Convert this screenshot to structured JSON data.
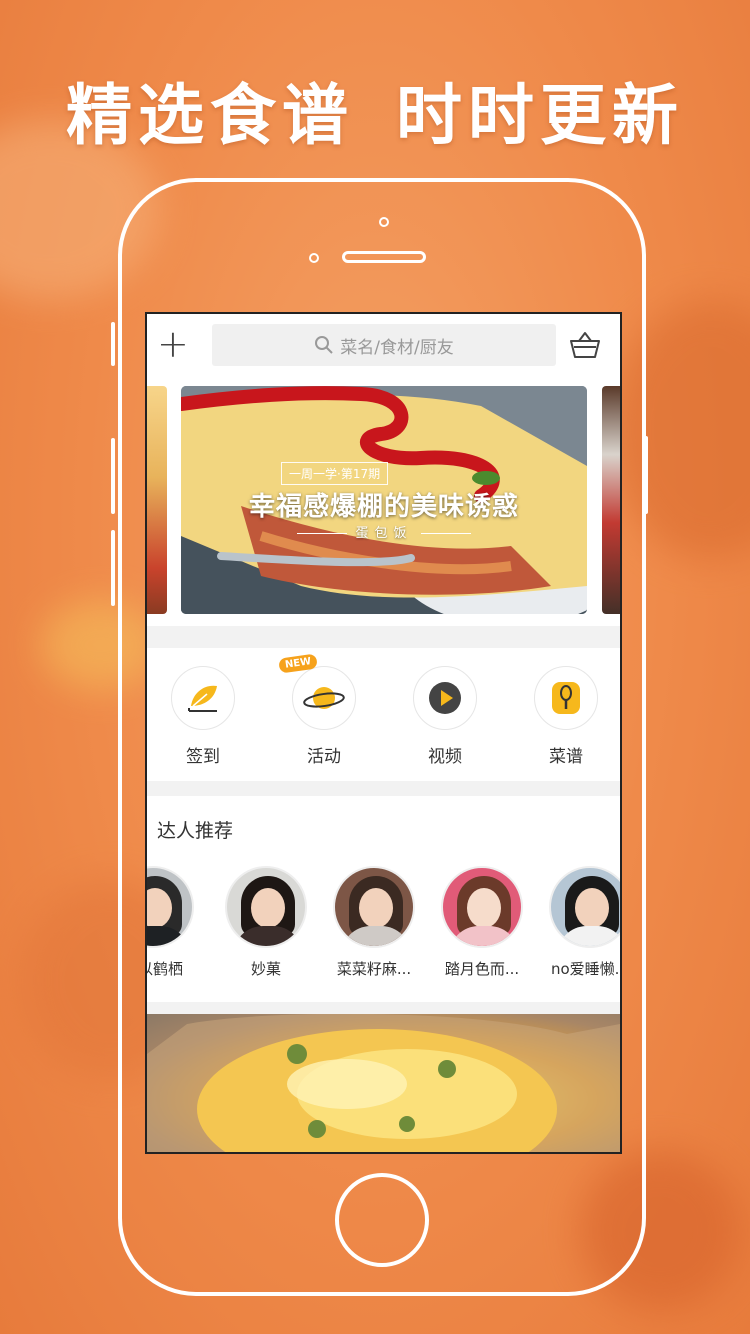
{
  "headline": {
    "left": "精选食谱",
    "right": "时时更新"
  },
  "topbar": {
    "search_placeholder": "菜名/食材/厨友"
  },
  "carousel": {
    "tag": "一周一学·第17期",
    "title": "幸福感爆棚的美味诱惑",
    "subtitle": "蛋包饭"
  },
  "quick_actions": [
    {
      "label": "签到",
      "icon": "feather-checkin-icon"
    },
    {
      "label": "活动",
      "icon": "planet-icon",
      "badge": "NEW"
    },
    {
      "label": "视频",
      "icon": "play-icon"
    },
    {
      "label": "菜谱",
      "icon": "recipe-whisk-icon"
    }
  ],
  "experts": {
    "title": "达人推荐",
    "items": [
      {
        "name": "栖以鹤栖"
      },
      {
        "name": "妙菓"
      },
      {
        "name": "菜菜籽麻..."
      },
      {
        "name": "踏月色而..."
      },
      {
        "name": "no爱睡懒..."
      }
    ]
  },
  "colors": {
    "accent": "#f6b81c",
    "brand_bg": "#ef8a4a"
  }
}
